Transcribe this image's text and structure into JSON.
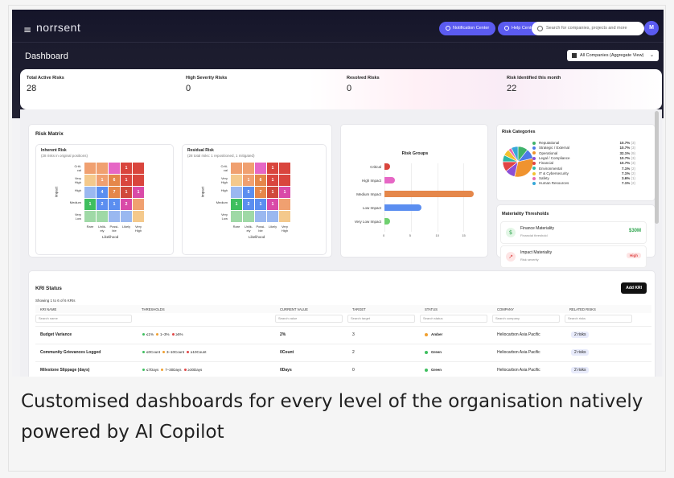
{
  "app": {
    "logo": "norrsent",
    "menu_icon": "≡",
    "notification_center": "Notification Center",
    "help_center": "Help Center",
    "search_placeholder": "Search for companies, projects and more",
    "avatar": "M",
    "page_title": "Dashboard",
    "company_selector": "All Companies (Aggregate View)",
    "accent": "#5b5bf0"
  },
  "stats": [
    {
      "label": "Total Active Risks",
      "value": "28"
    },
    {
      "label": "High Severity Risks",
      "value": "0"
    },
    {
      "label": "Resolved Risks",
      "value": "0"
    },
    {
      "label": "Risk Identified this month",
      "value": "22"
    }
  ],
  "risk_matrix": {
    "title": "Risk Matrix",
    "inherent": {
      "title": "Inherent Risk",
      "subtitle": "(28 risks in original positions)"
    },
    "residual": {
      "title": "Residual Risk",
      "subtitle": "(28 total risks: 1 repositioned, 1 mitigated)"
    },
    "y_labels": [
      "Criti-\ncal",
      "Very\nHigh",
      "High",
      "Medium",
      "Very\nLow"
    ],
    "x_labels": [
      "Rare",
      "Unlik-\nely",
      "Possi-\nble",
      "Likely",
      "Very\nHigh"
    ],
    "y_axis": "Impact",
    "x_axis": "Likelihood",
    "inherent_values": [
      [
        "",
        "",
        "",
        "1",
        ""
      ],
      [
        "",
        "1",
        "6",
        "1",
        ""
      ],
      [
        "",
        "4",
        "7",
        "1",
        "1"
      ],
      [
        "1",
        "2",
        "1",
        "2",
        ""
      ],
      [
        "",
        "",
        "",
        "",
        ""
      ]
    ],
    "residual_values": [
      [
        "",
        "",
        "",
        "1",
        ""
      ],
      [
        "",
        "1",
        "6",
        "1",
        ""
      ],
      [
        "",
        "5",
        "7",
        "1",
        "1"
      ],
      [
        "1",
        "2",
        "1",
        "1",
        ""
      ],
      [
        "",
        "",
        "",
        "",
        ""
      ]
    ]
  },
  "risk_groups": {
    "title": "Risk Groups"
  },
  "chart_data": {
    "type": "bar",
    "title": "Risk Groups",
    "categories": [
      "Critical",
      "High Impact",
      "Medium Impact",
      "Low Impact",
      "Very Low Impact"
    ],
    "values": [
      1,
      2,
      17,
      7,
      1
    ],
    "colors": [
      "#d9453d",
      "#e667c5",
      "#e5874a",
      "#5b8ef0",
      "#6fd06f"
    ],
    "xlim": [
      0,
      18
    ],
    "ticks": [
      "0",
      "5",
      "10",
      "15"
    ]
  },
  "risk_categories": {
    "title": "Risk Categories",
    "items": [
      {
        "name": "Reputational",
        "pct": "10.7%",
        "count": "(3)",
        "color": "#3fb36b"
      },
      {
        "name": "Strategic / External",
        "pct": "10.7%",
        "count": "(3)",
        "color": "#4d7ae8"
      },
      {
        "name": "Operational",
        "pct": "32.1%",
        "count": "(9)",
        "color": "#f0932f"
      },
      {
        "name": "Legal / Compliance",
        "pct": "10.7%",
        "count": "(3)",
        "color": "#8c4fd6"
      },
      {
        "name": "Financial",
        "pct": "10.7%",
        "count": "(3)",
        "color": "#e14444"
      },
      {
        "name": "Environmental",
        "pct": "7.1%",
        "count": "(2)",
        "color": "#2eb8a6"
      },
      {
        "name": "IT & Cybersecurity",
        "pct": "7.1%",
        "count": "(2)",
        "color": "#f2c230"
      },
      {
        "name": "Safety",
        "pct": "3.6%",
        "count": "(1)",
        "color": "#e86ab0"
      },
      {
        "name": "Human Resources",
        "pct": "7.1%",
        "count": "(2)",
        "color": "#36a8d8"
      }
    ]
  },
  "materiality": {
    "title": "Materiality Thresholds",
    "items": [
      {
        "name": "Finance Materiality",
        "desc": "Financial threshold",
        "value": "$30M"
      },
      {
        "name": "Impact Materiality",
        "desc": "Risk severity",
        "value": "High"
      }
    ]
  },
  "kri": {
    "title": "KRI Status",
    "add_button": "Add KRI",
    "showing": "Showing 1 to 6 of 6 KRIs",
    "columns": [
      "KRI NAME",
      "THRESHOLDS",
      "CURRENT VALUE",
      "TARGET",
      "STATUS",
      "COMPANY",
      "RELATED RISKS"
    ],
    "filters": [
      "Search name",
      "Search value",
      "Search target",
      "Search status",
      "Search company",
      "Search risks"
    ],
    "rows": [
      {
        "name": "Budget Variance",
        "t1": "≤1%",
        "t2": "1–3%",
        "t3": "≥5%",
        "value": "2%",
        "target": "3",
        "status": "Amber",
        "status_color": "#f0a030",
        "company": "Heliocarbon Asia Pacific",
        "risks": "2 risks"
      },
      {
        "name": "Community Grievances Logged",
        "t1": "≤0Count",
        "t2": "3–10Count",
        "t3": "≥10Count",
        "value": "0Count",
        "target": "2",
        "status": "Green",
        "status_color": "#3fbf5f",
        "company": "Heliocarbon Asia Pacific",
        "risks": "2 risks"
      },
      {
        "name": "Milestone Slippage (days)",
        "t1": "≤7Days",
        "t2": "7–30Days",
        "t3": "≥30Days",
        "value": "0Days",
        "target": "0",
        "status": "Green",
        "status_color": "#3fbf5f",
        "company": "Heliocarbon Asia Pacific",
        "risks": "2 risks"
      }
    ]
  },
  "caption": "Customised dashboards for every level of the organisation natively powered by AI Copilot"
}
